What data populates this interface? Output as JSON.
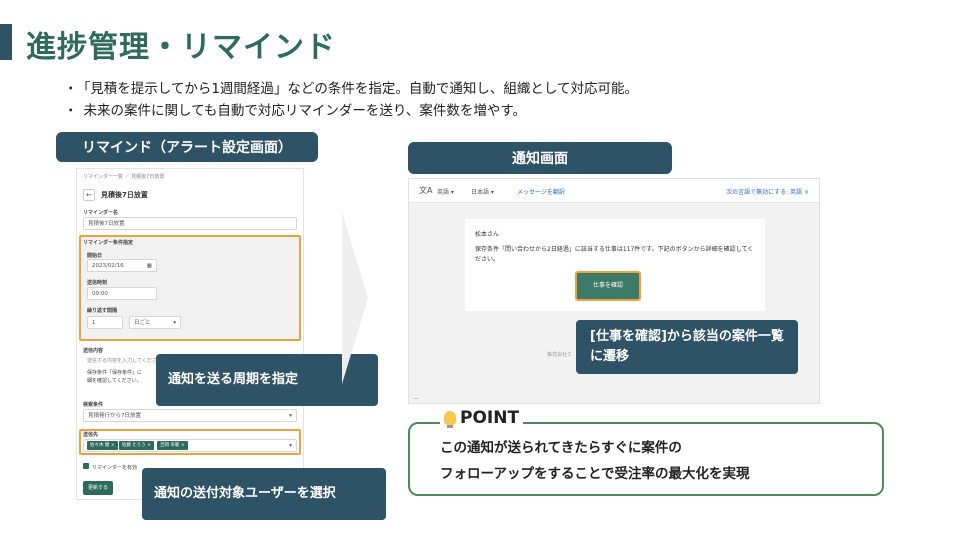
{
  "title": "進捗管理・リマインド",
  "bullets": [
    "「見積を提示してから1週間経過」などの条件を指定。自動で通知し、組織として対応可能。",
    "未来の案件に関しても自動で対応リマインダーを送り、案件数を増やす。"
  ],
  "left_panel": {
    "label": "リマインド（アラート設定画面）",
    "breadcrumb": "リマインダー一覧 ／ 見積後7日放置",
    "back_icon": "arrow-left-icon",
    "page_heading": "見積後7日放置",
    "name_label": "リマインダー名",
    "name_value": "見積後7日放置",
    "condition_label": "リマインダー条件指定",
    "start_date_label": "開始日",
    "start_date_value": "2023/02/16",
    "send_time_label": "送信時刻",
    "send_time_value": "09:00",
    "repeat_label": "繰り返す間隔",
    "repeat_value": "1",
    "repeat_unit": "日ごと",
    "content_label": "送信内容",
    "content_placeholder": "送信する内容を入力してください",
    "content_value_1": "保存条件「保存条件」に",
    "content_value_2": "細を確認してください。",
    "search_label": "検索条件",
    "search_value": "見積発行から7日放置",
    "recipients_label": "送信先",
    "recipients": [
      "佐々木 健",
      "佐藤 たろう",
      "吉岡 幸範"
    ],
    "checkbox_label": "リマインダーを有効",
    "submit_label": "更新する",
    "callout_cycle": "通知を送る周期を指定",
    "callout_users": "通知の送付対象ユーザーを選択"
  },
  "right_panel": {
    "label": "通知画面",
    "translate_icon": "translate-icon",
    "lang_from": "英語 ▾",
    "lang_to": "日本語 ▾",
    "translate_link": "メッセージを翻訳",
    "disable_link": "次の言語で無効にする: 英語 ×",
    "greeting": "松本さん",
    "body": "保存条件「問い合わせから2日経過」に該当する仕事は117件です。下記のボタンから詳細を確認してください。",
    "button_label": "仕事を確認",
    "footer": "株式会社ミ",
    "dash": "—",
    "callout": "[仕事を確認]から該当の案件一覧に遷移"
  },
  "point": {
    "icon": "lightbulb-icon",
    "heading": "POINT",
    "line1": "この通知が送られてきたらすぐに案件の",
    "line2": "フォローアップをすることで受注率の最大化を実現"
  }
}
